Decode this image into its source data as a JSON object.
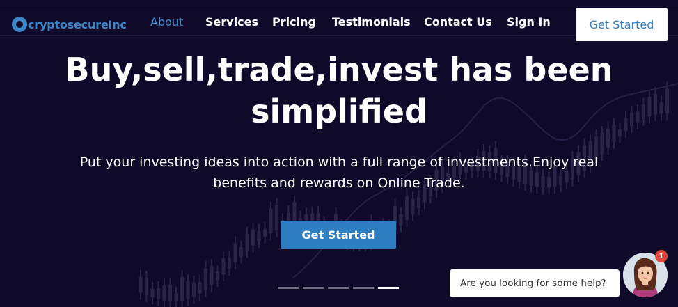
{
  "brand": {
    "name": "cryptosecureInc",
    "color": "#3a86c6"
  },
  "nav": {
    "items": [
      {
        "label": "About",
        "active": true
      },
      {
        "label": "Services",
        "active": false
      },
      {
        "label": "Pricing",
        "active": false
      },
      {
        "label": "Testimonials",
        "active": false
      },
      {
        "label": "Contact Us",
        "active": false
      },
      {
        "label": "Sign In",
        "active": false
      }
    ],
    "cta_label": "Get Started"
  },
  "hero": {
    "title_line1": "Buy,sell,trade,invest has been",
    "title_line2": "simplified",
    "subtitle_line1": "Put your investing ideas into action with a full range of investments.Enjoy real",
    "subtitle_line2": "benefits and rewards on Online Trade.",
    "cta_label": "Get Started"
  },
  "carousel": {
    "slide_count": 5,
    "active_index": 4
  },
  "chat": {
    "prompt": "Are you looking for some help?",
    "badge_count": "1",
    "avatar_icon": "support-agent-avatar"
  },
  "colors": {
    "background": "#100a2a",
    "accent": "#2f7ec2",
    "badge": "#e0453b"
  }
}
